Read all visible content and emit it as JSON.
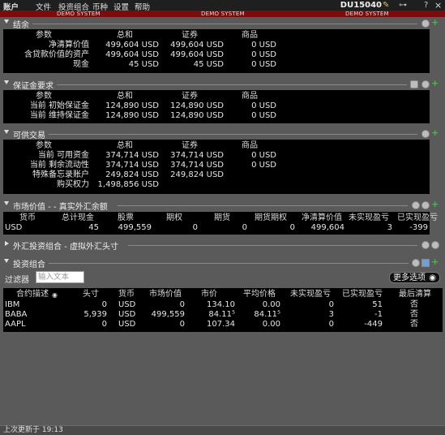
{
  "menu": [
    "账户",
    "文件",
    "投资组合",
    "币种",
    "设置",
    "帮助"
  ],
  "account_id": "DU15040",
  "demo_label": "DEMO SYSTEM",
  "sections": {
    "balances": {
      "title": "结余",
      "headers": [
        "参数",
        "总和",
        "证券",
        "商品"
      ],
      "rows": [
        [
          "净清算价值",
          "499,604 USD",
          "499,604 USD",
          "0 USD"
        ],
        [
          "含贷款价值的资产",
          "499,604 USD",
          "499,604 USD",
          "0 USD"
        ],
        [
          "现金",
          "45 USD",
          "45 USD",
          "0 USD"
        ]
      ]
    },
    "margin": {
      "title": "保证金要求",
      "headers": [
        "参数",
        "总和",
        "证券",
        "商品"
      ],
      "rows": [
        [
          "当前 初始保证金",
          "124,890 USD",
          "124,890 USD",
          "0 USD"
        ],
        [
          "当前 维持保证金",
          "124,890 USD",
          "124,890 USD",
          "0 USD"
        ]
      ]
    },
    "available": {
      "title": "可供交易",
      "headers": [
        "参数",
        "总和",
        "证券",
        "商品"
      ],
      "rows": [
        [
          "当前 可用资金",
          "374,714 USD",
          "374,714 USD",
          "0 USD"
        ],
        [
          "当前 剩余流动性",
          "374,714 USD",
          "374,714 USD",
          "0 USD"
        ],
        [
          "特殊备忘录账户",
          "249,824 USD",
          "249,824 USD",
          ""
        ],
        [
          "购买权力",
          "1,498,856 USD",
          "",
          ""
        ]
      ]
    },
    "market_value": {
      "title": "市场价值 - - 真实外汇余额",
      "headers": [
        "货币",
        "总计现金",
        "股票",
        "期权",
        "期货",
        "期货期权",
        "净清算价值",
        "未实现盈亏",
        "已实现盈亏"
      ],
      "rows": [
        [
          "USD",
          "45",
          "499,559",
          "0",
          "0",
          "0",
          "499,604",
          "3",
          "-399"
        ]
      ]
    },
    "fx_portfolio": {
      "title": "外汇投资组合 - 虚拟外汇头寸"
    },
    "portfolio": {
      "title": "投资组合",
      "filter_label": "过滤器",
      "filter_placeholder": "输入文本",
      "more_options": "更多选项",
      "headers": [
        "合约描述",
        "头寸",
        "货币",
        "市场价值",
        "市价",
        "平均价格",
        "未实现盈亏",
        "已实现盈亏",
        "最后清算"
      ],
      "rows": [
        [
          "IBM",
          "0",
          "USD",
          "0",
          "134.10",
          "0.00",
          "0",
          "51",
          "否"
        ],
        [
          "BABA",
          "5,939",
          "USD",
          "499,559",
          "84.11⁵",
          "84.11⁵",
          "3",
          "-1",
          "否"
        ],
        [
          "AAPL",
          "0",
          "USD",
          "0",
          "107.34",
          "0.00",
          "0",
          "-449",
          "否"
        ]
      ]
    }
  },
  "status": "上次更新于 19:13"
}
